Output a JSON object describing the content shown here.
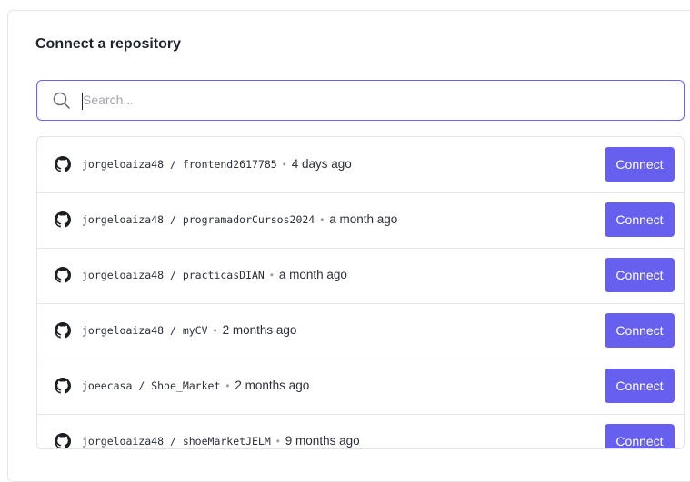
{
  "panel": {
    "title": "Connect a repository"
  },
  "search": {
    "placeholder": "Search...",
    "icon": "search-icon"
  },
  "repositories": [
    {
      "owner": "jorgeloaiza48",
      "separator": "/",
      "name": "frontend2617785",
      "time": "4 days ago",
      "button": "Connect"
    },
    {
      "owner": "jorgeloaiza48",
      "separator": "/",
      "name": "programadorCursos2024",
      "time": "a month ago",
      "button": "Connect"
    },
    {
      "owner": "jorgeloaiza48",
      "separator": "/",
      "name": "practicasDIAN",
      "time": "a month ago",
      "button": "Connect"
    },
    {
      "owner": "jorgeloaiza48",
      "separator": "/",
      "name": "myCV",
      "time": "2 months ago",
      "button": "Connect"
    },
    {
      "owner": "joeecasa",
      "separator": "/",
      "name": "Shoe_Market",
      "time": "2 months ago",
      "button": "Connect"
    },
    {
      "owner": "jorgeloaiza48",
      "separator": "/",
      "name": "shoeMarketJELM",
      "time": "9 months ago",
      "button": "Connect"
    }
  ],
  "colors": {
    "accent": "#6760ee",
    "focus_border": "#6d63f0"
  }
}
